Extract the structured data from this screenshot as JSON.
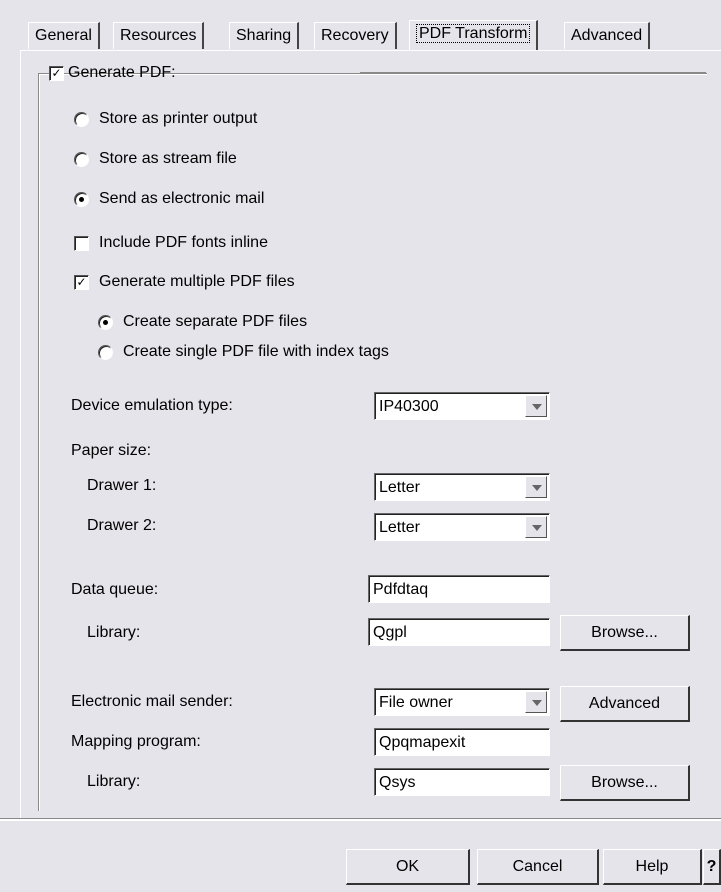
{
  "tabs": [
    {
      "label": "General"
    },
    {
      "label": "Resources"
    },
    {
      "label": "Sharing"
    },
    {
      "label": "Recovery"
    },
    {
      "label": "PDF Transform"
    },
    {
      "label": "Advanced"
    }
  ],
  "active_tab": "PDF Transform",
  "generate_pdf": {
    "label": "Generate PDF:",
    "checked": true
  },
  "output_options": [
    {
      "label": "Store as printer output",
      "selected": false
    },
    {
      "label": "Store as stream file",
      "selected": false
    },
    {
      "label": "Send as electronic mail",
      "selected": true
    }
  ],
  "include_fonts": {
    "label": "Include PDF fonts inline",
    "checked": false
  },
  "multiple_files": {
    "label": "Generate multiple PDF files",
    "checked": true
  },
  "multiple_options": [
    {
      "label": "Create separate PDF files",
      "selected": true
    },
    {
      "label": "Create single PDF file with index tags",
      "selected": false
    }
  ],
  "device_emulation": {
    "label": "Device emulation type:",
    "value": "IP40300"
  },
  "paper_size": {
    "label": "Paper size:",
    "drawer1": {
      "label": "Drawer 1:",
      "value": "Letter"
    },
    "drawer2": {
      "label": "Drawer 2:",
      "value": "Letter"
    }
  },
  "data_queue": {
    "label": "Data queue:",
    "value": "Pdfdtaq",
    "library_label": "Library:",
    "library_value": "Qgpl",
    "browse_label": "Browse..."
  },
  "mail_sender": {
    "label": "Electronic mail sender:",
    "value": "File owner",
    "advanced_label": "Advanced"
  },
  "mapping_program": {
    "label": "Mapping program:",
    "value": "Qpqmapexit",
    "library_label": "Library:",
    "library_value": "Qsys",
    "browse_label": "Browse..."
  },
  "footer": {
    "ok": "OK",
    "cancel": "Cancel",
    "help": "Help",
    "whats_this": "?"
  },
  "colors": {
    "window_bg": "#e6e4eb",
    "field_bg": "#ffffff"
  }
}
